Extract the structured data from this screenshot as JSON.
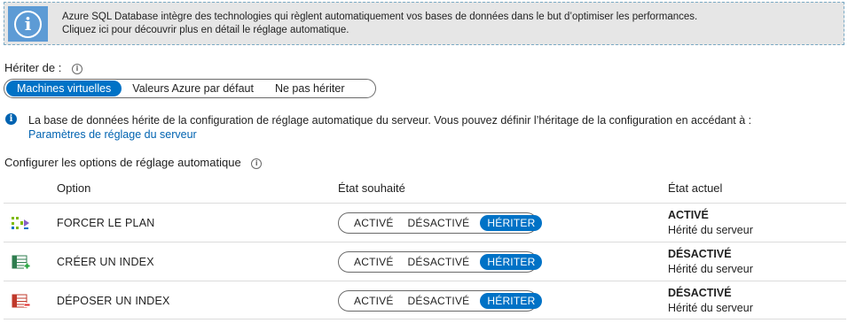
{
  "banner": {
    "line1": "Azure SQL Database intègre des technologies qui règlent automatiquement vos bases de données dans le but d’optimiser les performances.",
    "line2": "Cliquez ici pour découvrir plus en détail le réglage automatique.",
    "icon": "info-icon"
  },
  "inherit": {
    "label": "Hériter de :",
    "options": [
      "Machines virtuelles",
      "Valeurs Azure par défaut",
      "Ne pas hériter"
    ],
    "selected": "Machines virtuelles"
  },
  "note": {
    "text": "La base de données hérite de la configuration de réglage automatique du serveur. Vous pouvez définir l’héritage de la configuration en accédant à :",
    "link": "Paramètres de réglage du serveur"
  },
  "section_title": "Configurer les options de réglage automatique",
  "table": {
    "headers": {
      "option": "Option",
      "desired": "État souhaité",
      "current": "État actuel"
    },
    "toggle_labels": [
      "ACTIVÉ",
      "DÉSACTIVÉ",
      "HÉRITER"
    ],
    "rows": [
      {
        "icon": "force-plan-icon",
        "name": "FORCER LE PLAN",
        "desired": "HÉRITER",
        "current": "ACTIVÉ",
        "current_sub": "Hérité du serveur"
      },
      {
        "icon": "create-index-icon",
        "name": "CRÉER UN INDEX",
        "desired": "HÉRITER",
        "current": "DÉSACTIVÉ",
        "current_sub": "Hérité du serveur"
      },
      {
        "icon": "drop-index-icon",
        "name": "DÉPOSER UN INDEX",
        "desired": "HÉRITER",
        "current": "DÉSACTIVÉ",
        "current_sub": "Hérité du serveur"
      }
    ]
  },
  "colors": {
    "accent": "#0072c6",
    "link": "#0063b1",
    "banner_bg": "#e6e6e6",
    "banner_icon_bg": "#5d9bd5"
  }
}
